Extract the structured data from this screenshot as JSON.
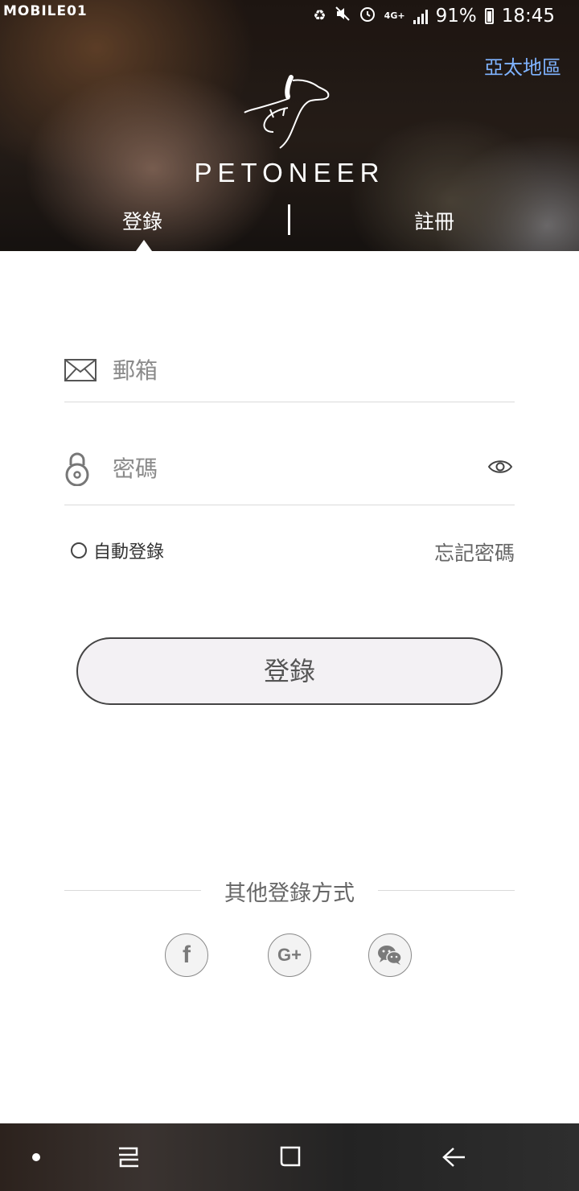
{
  "status_bar": {
    "left_badge": "MOBILE01",
    "network": "4G+",
    "battery": "91%",
    "time": "18:45"
  },
  "header": {
    "region_link": "亞太地區",
    "brand": "PETONEER",
    "tabs": [
      {
        "label": "登錄",
        "active": true
      },
      {
        "label": "註冊",
        "active": false
      }
    ]
  },
  "form": {
    "email_placeholder": "郵箱",
    "email_value": "",
    "password_placeholder": "密碼",
    "password_value": "",
    "auto_login_label": "自動登錄",
    "forgot_password": "忘記密碼",
    "login_button": "登錄"
  },
  "other_login": {
    "label": "其他登錄方式",
    "providers": [
      "facebook-icon",
      "google-plus-icon",
      "wechat-icon"
    ]
  },
  "nav": {
    "icons": [
      "nav-dot-icon",
      "recent-apps-icon",
      "home-icon",
      "back-icon"
    ]
  },
  "colors": {
    "region_link": "#7fb3ff",
    "button_fill": "#f3f1f4",
    "divider": "#dadada"
  }
}
